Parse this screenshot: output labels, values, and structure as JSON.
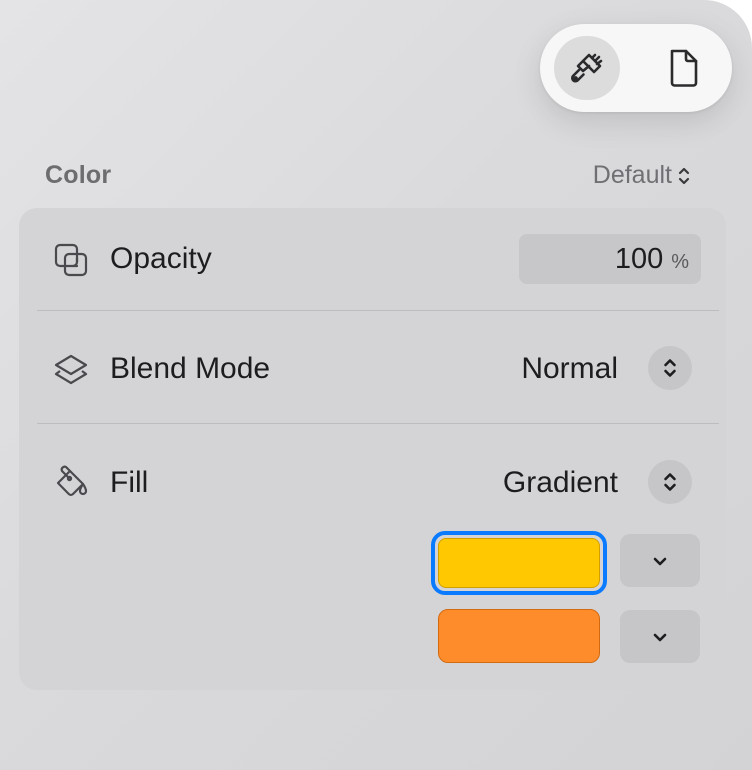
{
  "toolbar": {
    "buttons": [
      {
        "name": "paintbrush-icon",
        "selected": true
      },
      {
        "name": "document-icon",
        "selected": false
      }
    ]
  },
  "color_section": {
    "title": "Color",
    "preset": "Default"
  },
  "opacity": {
    "label": "Opacity",
    "value": "100",
    "unit": "%"
  },
  "blend_mode": {
    "label": "Blend Mode",
    "value": "Normal"
  },
  "fill": {
    "label": "Fill",
    "type": "Gradient",
    "stops": [
      {
        "color": "#FFC800",
        "selected": true
      },
      {
        "color": "#FF8C2A",
        "selected": false
      }
    ]
  },
  "colors": {
    "accent": "#0A7AFF"
  }
}
